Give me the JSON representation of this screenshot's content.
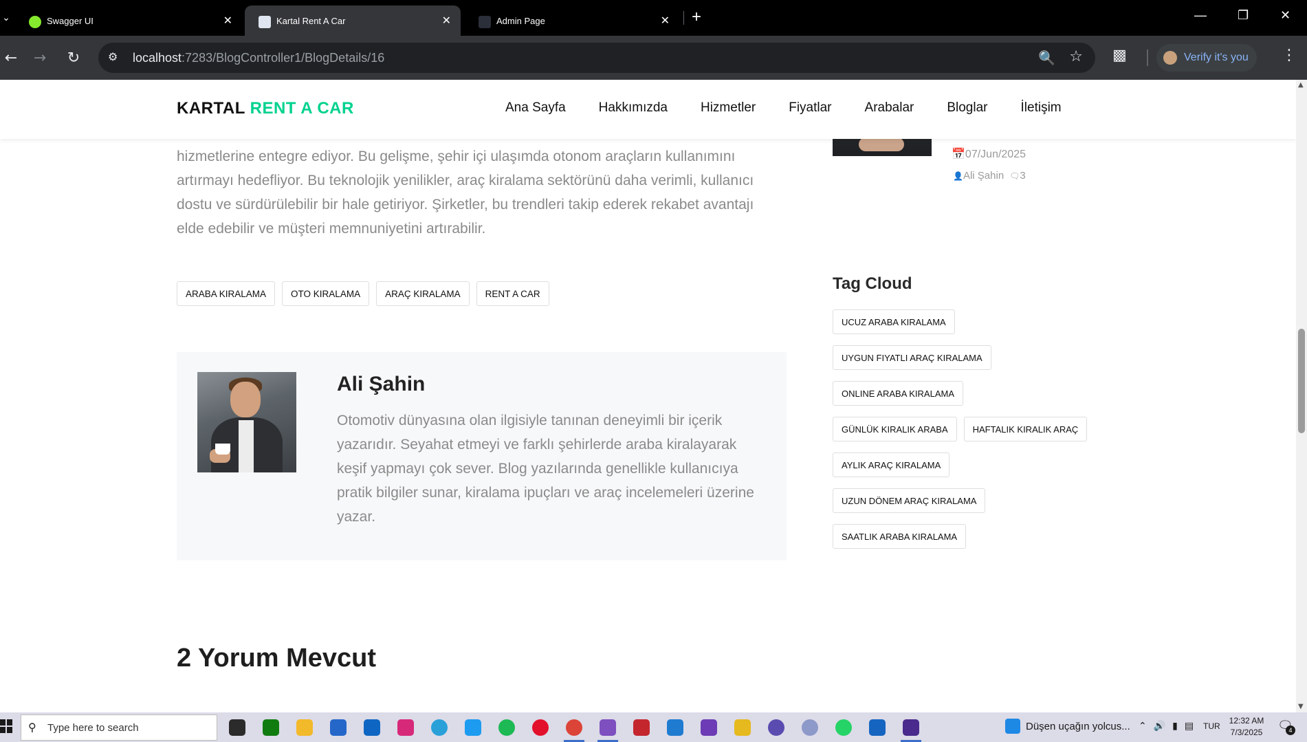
{
  "browser": {
    "tabs": [
      {
        "title": "Swagger UI",
        "favicon_color": "#85ea2d"
      },
      {
        "title": "Kartal Rent A Car",
        "favicon_color": "#dfe6f1"
      },
      {
        "title": "Admin Page",
        "favicon_color": "#2b2f3a"
      }
    ],
    "url_host": "localhost",
    "url_path": ":7283/BlogController1/BlogDetails/16",
    "profile_label": "Verify it's you"
  },
  "site": {
    "logo_part1": "KARTAL",
    "logo_part2": "RENT A CAR",
    "brand_color": "#01d28e",
    "nav": [
      "Ana Sayfa",
      "Hakkımızda",
      "Hizmetler",
      "Fiyatlar",
      "Arabalar",
      "Bloglar",
      "İletişim"
    ]
  },
  "article": {
    "body_tail": "hizmetlerine entegre ediyor. Bu gelişme, şehir içi ulaşımda otonom araçların kullanımını artırmayı hedefliyor. Bu teknolojik yenilikler, araç kiralama sektörünü daha verimli, kullanıcı dostu ve sürdürülebilir bir hale getiriyor. Şirketler, bu trendleri takip ederek rekabet avantajı elde edebilir ve müşteri memnuniyetini artırabilir.",
    "tags": [
      "ARABA KIRALAMA",
      "OTO KIRALAMA",
      "ARAÇ KIRALAMA",
      "RENT A CAR"
    ]
  },
  "author": {
    "name": "Ali Şahin",
    "bio": "Otomotiv dünyasına olan ilgisiyle tanınan deneyimli bir içerik yazarıdır. Seyahat etmeyi ve farklı şehirlerde araba kiralayarak keşif yapmayı çok sever. Blog yazılarında genellikle kullanıcıya pratik bilgiler sunar, kiralama ipuçları ve araç incelemeleri üzerine yazar."
  },
  "comments": {
    "heading": "2 Yorum Mevcut"
  },
  "sidebar": {
    "recent_post": {
      "date": "07/Jun/2025",
      "author": "Ali Şahin",
      "comment_count": "3"
    },
    "tag_cloud_title": "Tag Cloud",
    "tag_cloud": [
      "UCUZ ARABA KIRALAMA",
      "UYGUN FIYATLI ARAÇ KIRALAMA",
      "ONLINE ARABA KIRALAMA",
      "GÜNLÜK KIRALIK ARABA",
      "HAFTALIK KIRALIK ARAÇ",
      "AYLIK ARAÇ KIRALAMA",
      "UZUN DÖNEM ARAÇ KIRALAMA",
      "SAATLIK ARABA KIRALAMA"
    ]
  },
  "taskbar": {
    "search_placeholder": "Type here to search",
    "news_text": "Düşen uçağın yolcus...",
    "language": "TUR",
    "time": "12:32 AM",
    "date": "7/3/2025",
    "notification_count": "4",
    "apps": [
      {
        "name": "task-view-icon",
        "color": "#2b2b2b"
      },
      {
        "name": "xbox-icon",
        "color": "#107c10"
      },
      {
        "name": "file-explorer-icon",
        "color": "#f2b92a"
      },
      {
        "name": "microsoft-store-icon",
        "color": "#2467c9"
      },
      {
        "name": "outlook-icon",
        "color": "#0f66c2"
      },
      {
        "name": "instagram-icon",
        "color": "#d6297a"
      },
      {
        "name": "telegram-icon",
        "color": "#2aa0d9"
      },
      {
        "name": "twitter-icon",
        "color": "#1d9bf0"
      },
      {
        "name": "spotify-icon",
        "color": "#1db954"
      },
      {
        "name": "opera-icon",
        "color": "#e3102b"
      },
      {
        "name": "chrome-icon",
        "color": "#db4437"
      },
      {
        "name": "visual-studio-icon",
        "color": "#7d4fbf"
      },
      {
        "name": "app-red-icon",
        "color": "#c4262e"
      },
      {
        "name": "vscode-icon",
        "color": "#1f7bd0"
      },
      {
        "name": "visual-studio-2-icon",
        "color": "#6c3bb5"
      },
      {
        "name": "app-yellow-icon",
        "color": "#e6b91e"
      },
      {
        "name": "app-swirl-icon",
        "color": "#5a4bb0"
      },
      {
        "name": "r-icon",
        "color": "#8d99c9"
      },
      {
        "name": "whatsapp-icon",
        "color": "#25d366"
      },
      {
        "name": "app-blue-icon",
        "color": "#1565c0"
      },
      {
        "name": "app-purple-icon",
        "color": "#4a2a8c"
      }
    ]
  }
}
